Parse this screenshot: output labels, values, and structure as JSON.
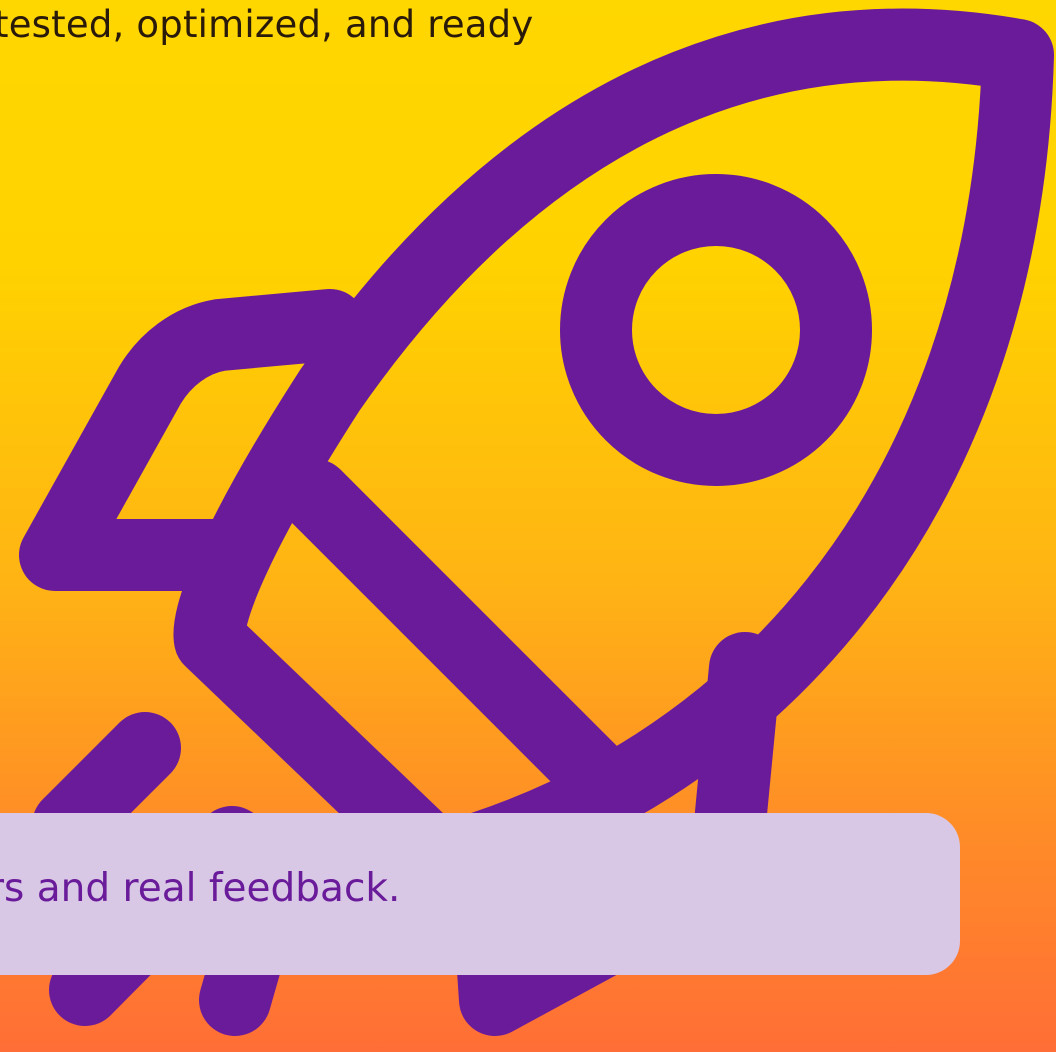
{
  "header": {
    "line": "tested, optimized, and ready"
  },
  "callout": {
    "text": "rs and real feedback."
  },
  "colors": {
    "background_top": "#FFD700",
    "background_bottom": "#FF6E36",
    "rocket": "#6A1B9A",
    "callout_bg": "#D9C7E6",
    "callout_text": "#6A1B9A"
  },
  "icons": {
    "rocket": "rocket-icon"
  }
}
